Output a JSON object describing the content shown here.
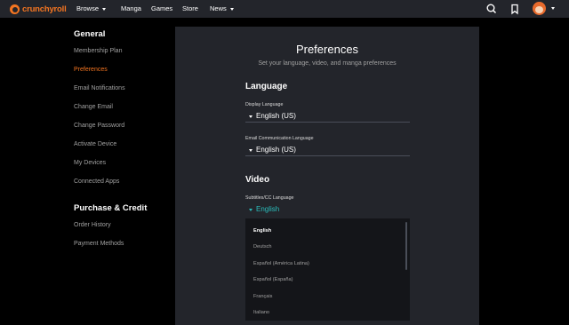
{
  "header": {
    "brand": "crunchyroll",
    "nav": [
      "Browse",
      "Manga",
      "Games",
      "Store",
      "News"
    ],
    "icons": [
      "search-icon",
      "bookmark-icon"
    ]
  },
  "sidebar": {
    "general_heading": "General",
    "general_items": [
      "Membership Plan",
      "Preferences",
      "Email Notifications",
      "Change Email",
      "Change Password",
      "Activate Device",
      "My Devices",
      "Connected Apps"
    ],
    "purchase_heading": "Purchase & Credit",
    "purchase_items": [
      "Order History",
      "Payment Methods"
    ]
  },
  "main": {
    "title": "Preferences",
    "subtitle": "Set your language, video, and manga preferences",
    "language_heading": "Language",
    "display_language_label": "Display Language",
    "display_language_value": "English (US)",
    "email_language_label": "Email Communication Language",
    "email_language_value": "English (US)",
    "video_heading": "Video",
    "subtitles_label": "Subtitles/CC Language",
    "subtitles_value": "English",
    "subtitle_options": [
      "English",
      "Deutsch",
      "Español (América Latina)",
      "Español (España)",
      "Français",
      "Italiano"
    ]
  },
  "colors": {
    "accent": "#f47521",
    "teal": "#2abdbb",
    "panel": "#23252b"
  }
}
